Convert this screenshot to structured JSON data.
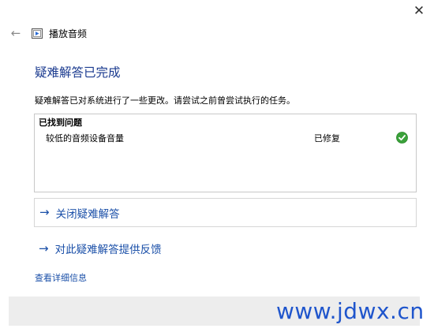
{
  "window": {
    "close_symbol": "✕",
    "back_symbol": "←",
    "app_icon": "media-player-icon",
    "title": "播放音频"
  },
  "main": {
    "heading": "疑难解答已完成",
    "description": "疑难解答已对系统进行了一些更改。请尝试之前曾尝试执行的任务。"
  },
  "results": {
    "header": "已找到问题",
    "problems": [
      {
        "name": "较低的音频设备音量",
        "status": "已修复",
        "status_icon": "check-icon"
      }
    ]
  },
  "actions": {
    "arrow_symbol": "→",
    "close_troubleshooter": "关闭疑难解答",
    "feedback": "对此疑难解答提供反馈",
    "view_details": "查看详细信息"
  },
  "watermark": "www.jdwx.cn",
  "colors": {
    "heading": "#1a3a8f",
    "link": "#1a4fa8",
    "check_green": "#3aa13a",
    "footer_bg": "#ededed"
  }
}
